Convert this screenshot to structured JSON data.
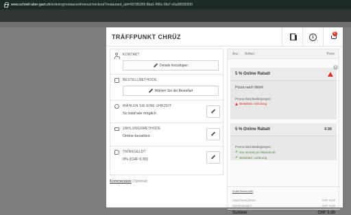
{
  "browser": {
    "url_host": "www.schnell-aber-guet.ch",
    "url_path": "/ordering/restaurant/menu/checkout?restaurant_uid=65785265-8ba1-496c-9fa7-c6a38026900"
  },
  "header": {
    "title": "TRÄFFPUNKT CHRÜZ",
    "cart_count": "0",
    "info_glyph": "i"
  },
  "sections": {
    "kontakt": {
      "label": "KONTAKT",
      "button": "Details hinzufügen"
    },
    "bestellmethode": {
      "label": "BESTELLMETHODE",
      "button": "Wählen Sie die Bestellart"
    },
    "uhrzeit": {
      "label": "WÄHLEN SIE EINE UHRZEIT",
      "value": "So bald wie möglich"
    },
    "zahlung": {
      "label": "ZAHLUNGSMETHODE",
      "value": "Online bezahlen"
    },
    "trinkgeld": {
      "label": "TRINKGELD?",
      "value": "0% (CHF 0.00)"
    }
  },
  "comments": {
    "label": "Kommentare",
    "optional": "(Optional)"
  },
  "cart": {
    "columns": {
      "qty": "Anz",
      "item": "Artikel",
      "price": "Preis"
    },
    "items": [
      {
        "title": "5 % Online Rabatt",
        "subtitle": "Pizza nach Wahl",
        "conditions_label": "Promo Deal Bedingungen:",
        "conditions": [
          {
            "text": "Bestellart: Abholung",
            "status": "error"
          }
        ]
      },
      {
        "title": "5 % Online Rabatt",
        "price": "0.00",
        "conditions_label": "Promo Deal Bedingungen:",
        "conditions": [
          {
            "text": "Nur einmal pro Warenkorb",
            "status": "ok"
          },
          {
            "text": "Bestellart: Lieferung",
            "status": "ok"
          }
        ]
      }
    ],
    "voucher_link": "Gutscheincode",
    "subtotal_label": "Zwischensumme",
    "subtotal_value": "CHF 0.00",
    "service_label": "Systemkosten",
    "service_value": "CHF 0.00",
    "total_label": "Summe",
    "total_value": "CHF 0.00"
  },
  "icons": {
    "lock": "lock-icon",
    "book": "menu-book-icon",
    "info": "info-icon",
    "cart": "cart-icon",
    "user": "user-icon",
    "doc": "document-icon",
    "clock": "clock-icon",
    "card": "credit-card-icon",
    "tag": "tag-icon",
    "pen": "pencil-icon",
    "warning": "warning-icon",
    "check": "check-icon"
  },
  "colors": {
    "error": "#d93025",
    "ok": "#4b8a3c",
    "accent_badge": "#d93025"
  }
}
